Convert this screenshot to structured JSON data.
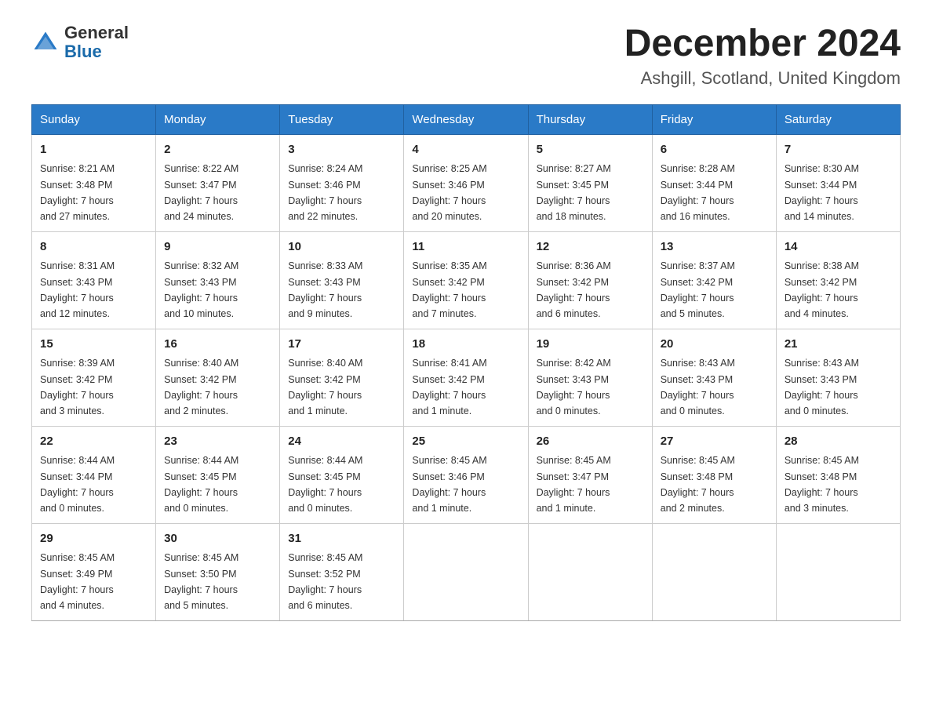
{
  "header": {
    "logo_general": "General",
    "logo_blue": "Blue",
    "month_title": "December 2024",
    "location": "Ashgill, Scotland, United Kingdom"
  },
  "days_of_week": [
    "Sunday",
    "Monday",
    "Tuesday",
    "Wednesday",
    "Thursday",
    "Friday",
    "Saturday"
  ],
  "weeks": [
    [
      {
        "day": "1",
        "sunrise": "8:21 AM",
        "sunset": "3:48 PM",
        "daylight": "7 hours and 27 minutes."
      },
      {
        "day": "2",
        "sunrise": "8:22 AM",
        "sunset": "3:47 PM",
        "daylight": "7 hours and 24 minutes."
      },
      {
        "day": "3",
        "sunrise": "8:24 AM",
        "sunset": "3:46 PM",
        "daylight": "7 hours and 22 minutes."
      },
      {
        "day": "4",
        "sunrise": "8:25 AM",
        "sunset": "3:46 PM",
        "daylight": "7 hours and 20 minutes."
      },
      {
        "day": "5",
        "sunrise": "8:27 AM",
        "sunset": "3:45 PM",
        "daylight": "7 hours and 18 minutes."
      },
      {
        "day": "6",
        "sunrise": "8:28 AM",
        "sunset": "3:44 PM",
        "daylight": "7 hours and 16 minutes."
      },
      {
        "day": "7",
        "sunrise": "8:30 AM",
        "sunset": "3:44 PM",
        "daylight": "7 hours and 14 minutes."
      }
    ],
    [
      {
        "day": "8",
        "sunrise": "8:31 AM",
        "sunset": "3:43 PM",
        "daylight": "7 hours and 12 minutes."
      },
      {
        "day": "9",
        "sunrise": "8:32 AM",
        "sunset": "3:43 PM",
        "daylight": "7 hours and 10 minutes."
      },
      {
        "day": "10",
        "sunrise": "8:33 AM",
        "sunset": "3:43 PM",
        "daylight": "7 hours and 9 minutes."
      },
      {
        "day": "11",
        "sunrise": "8:35 AM",
        "sunset": "3:42 PM",
        "daylight": "7 hours and 7 minutes."
      },
      {
        "day": "12",
        "sunrise": "8:36 AM",
        "sunset": "3:42 PM",
        "daylight": "7 hours and 6 minutes."
      },
      {
        "day": "13",
        "sunrise": "8:37 AM",
        "sunset": "3:42 PM",
        "daylight": "7 hours and 5 minutes."
      },
      {
        "day": "14",
        "sunrise": "8:38 AM",
        "sunset": "3:42 PM",
        "daylight": "7 hours and 4 minutes."
      }
    ],
    [
      {
        "day": "15",
        "sunrise": "8:39 AM",
        "sunset": "3:42 PM",
        "daylight": "7 hours and 3 minutes."
      },
      {
        "day": "16",
        "sunrise": "8:40 AM",
        "sunset": "3:42 PM",
        "daylight": "7 hours and 2 minutes."
      },
      {
        "day": "17",
        "sunrise": "8:40 AM",
        "sunset": "3:42 PM",
        "daylight": "7 hours and 1 minute."
      },
      {
        "day": "18",
        "sunrise": "8:41 AM",
        "sunset": "3:42 PM",
        "daylight": "7 hours and 1 minute."
      },
      {
        "day": "19",
        "sunrise": "8:42 AM",
        "sunset": "3:43 PM",
        "daylight": "7 hours and 0 minutes."
      },
      {
        "day": "20",
        "sunrise": "8:43 AM",
        "sunset": "3:43 PM",
        "daylight": "7 hours and 0 minutes."
      },
      {
        "day": "21",
        "sunrise": "8:43 AM",
        "sunset": "3:43 PM",
        "daylight": "7 hours and 0 minutes."
      }
    ],
    [
      {
        "day": "22",
        "sunrise": "8:44 AM",
        "sunset": "3:44 PM",
        "daylight": "7 hours and 0 minutes."
      },
      {
        "day": "23",
        "sunrise": "8:44 AM",
        "sunset": "3:45 PM",
        "daylight": "7 hours and 0 minutes."
      },
      {
        "day": "24",
        "sunrise": "8:44 AM",
        "sunset": "3:45 PM",
        "daylight": "7 hours and 0 minutes."
      },
      {
        "day": "25",
        "sunrise": "8:45 AM",
        "sunset": "3:46 PM",
        "daylight": "7 hours and 1 minute."
      },
      {
        "day": "26",
        "sunrise": "8:45 AM",
        "sunset": "3:47 PM",
        "daylight": "7 hours and 1 minute."
      },
      {
        "day": "27",
        "sunrise": "8:45 AM",
        "sunset": "3:48 PM",
        "daylight": "7 hours and 2 minutes."
      },
      {
        "day": "28",
        "sunrise": "8:45 AM",
        "sunset": "3:48 PM",
        "daylight": "7 hours and 3 minutes."
      }
    ],
    [
      {
        "day": "29",
        "sunrise": "8:45 AM",
        "sunset": "3:49 PM",
        "daylight": "7 hours and 4 minutes."
      },
      {
        "day": "30",
        "sunrise": "8:45 AM",
        "sunset": "3:50 PM",
        "daylight": "7 hours and 5 minutes."
      },
      {
        "day": "31",
        "sunrise": "8:45 AM",
        "sunset": "3:52 PM",
        "daylight": "7 hours and 6 minutes."
      },
      null,
      null,
      null,
      null
    ]
  ],
  "labels": {
    "sunrise": "Sunrise:",
    "sunset": "Sunset:",
    "daylight": "Daylight:"
  }
}
